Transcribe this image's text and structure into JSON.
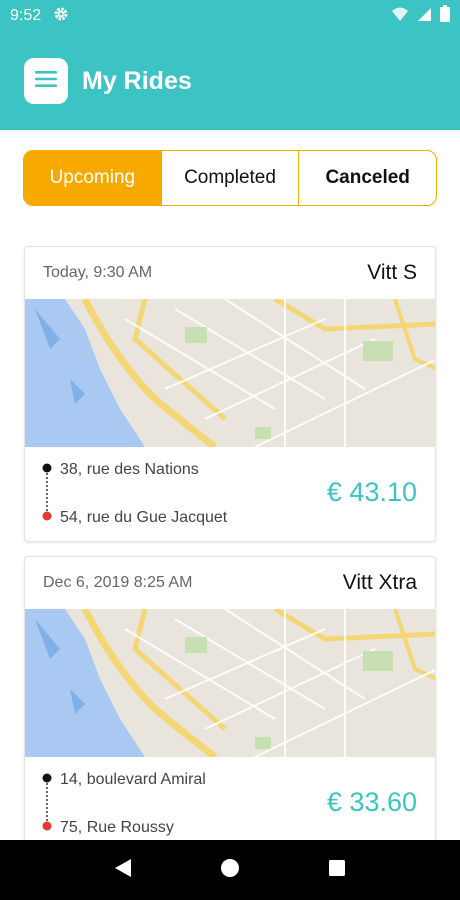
{
  "status_bar": {
    "time": "9:52"
  },
  "app_bar": {
    "title": "My Rides"
  },
  "tabs": [
    {
      "label": "Upcoming",
      "active": true
    },
    {
      "label": "Completed",
      "active": false
    },
    {
      "label": "Canceled",
      "active": false
    }
  ],
  "rides": [
    {
      "date": "Today, 9:30 AM",
      "vehicle": "Vitt S",
      "pickup": "38, rue des Nations",
      "dropoff": "54, rue du Gue Jacquet",
      "price": "€ 43.10"
    },
    {
      "date": "Dec 6, 2019 8:25 AM",
      "vehicle": "Vitt Xtra",
      "pickup": "14, boulevard Amiral",
      "dropoff": "75, Rue Roussy",
      "price": "€ 33.60"
    }
  ],
  "colors": {
    "primary": "#3cc4c4",
    "accent": "#f7a900",
    "pickup_dot": "#111111",
    "dropoff_dot": "#e53935"
  },
  "icons": {
    "settings": "gear-icon",
    "wifi": "wifi-icon",
    "signal": "signal-icon",
    "battery": "battery-icon",
    "menu": "hamburger-menu-icon",
    "back": "back-triangle-icon",
    "home": "home-circle-icon",
    "recents": "recents-square-icon"
  }
}
